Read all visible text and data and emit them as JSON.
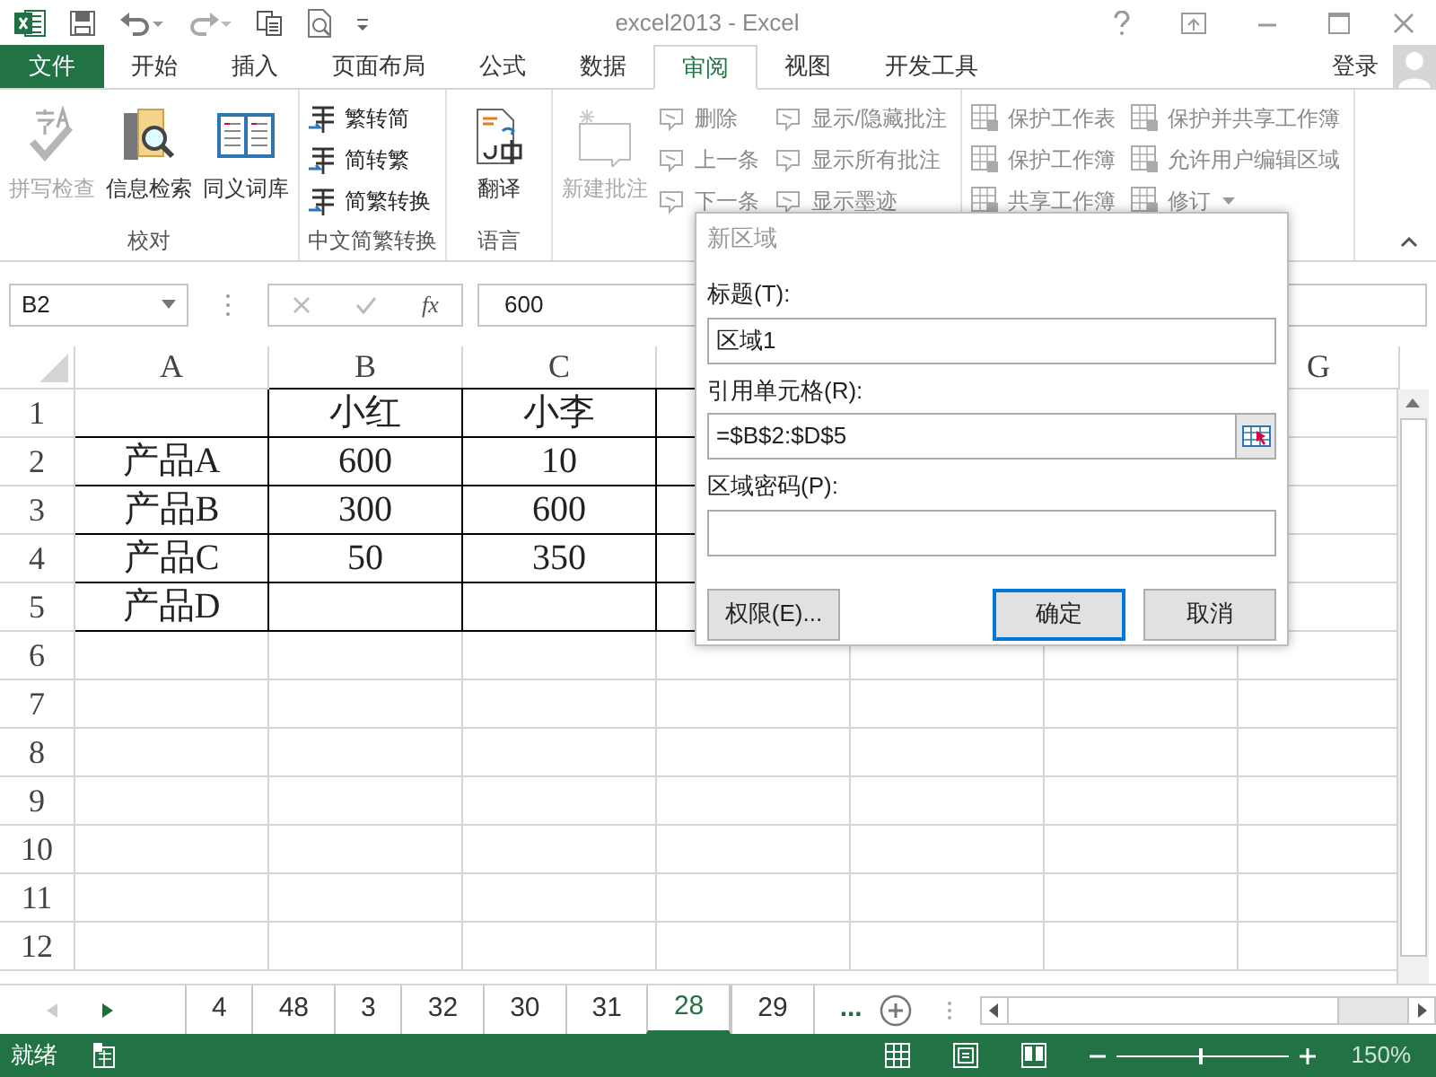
{
  "title_bar": {
    "title": "excel2013 - Excel"
  },
  "tabs": [
    {
      "label": "文件",
      "kind": "file",
      "selected": false
    },
    {
      "label": "开始",
      "kind": "tab",
      "selected": false
    },
    {
      "label": "插入",
      "kind": "tab",
      "selected": false
    },
    {
      "label": "页面布局",
      "kind": "tab",
      "selected": false
    },
    {
      "label": "公式",
      "kind": "tab",
      "selected": false
    },
    {
      "label": "数据",
      "kind": "tab",
      "selected": false
    },
    {
      "label": "审阅",
      "kind": "tab",
      "selected": true
    },
    {
      "label": "视图",
      "kind": "tab",
      "selected": false
    },
    {
      "label": "开发工具",
      "kind": "tab",
      "selected": false
    }
  ],
  "account": {
    "label": "登录"
  },
  "ribbon": {
    "groups": [
      {
        "label": "校对",
        "controls": [
          {
            "kind": "large",
            "label": "拼写检查",
            "disabled": true
          },
          {
            "kind": "large",
            "label": "信息检索",
            "disabled": false
          },
          {
            "kind": "large",
            "label": "同义词库",
            "disabled": false
          }
        ]
      },
      {
        "label": "中文简繁转换",
        "controls": [
          {
            "kind": "stack",
            "items": [
              {
                "label": "繁转简",
                "disabled": false
              },
              {
                "label": "简转繁",
                "disabled": false
              },
              {
                "label": "简繁转换",
                "disabled": false
              }
            ]
          }
        ]
      },
      {
        "label": "语言",
        "controls": [
          {
            "kind": "large",
            "label": "翻译",
            "disabled": false
          }
        ]
      },
      {
        "controls": [
          {
            "kind": "large",
            "label": "新建批注",
            "disabled": true
          },
          {
            "kind": "stack",
            "items": [
              {
                "label": "删除",
                "disabled": true
              },
              {
                "label": "上一条",
                "disabled": true
              },
              {
                "label": "下一条",
                "disabled": true
              }
            ]
          },
          {
            "kind": "stack",
            "items": [
              {
                "label": "显示/隐藏批注",
                "disabled": true
              },
              {
                "label": "显示所有批注",
                "disabled": true
              },
              {
                "label": "显示墨迹",
                "disabled": true
              }
            ]
          }
        ]
      },
      {
        "controls": [
          {
            "kind": "stack",
            "items": [
              {
                "label": "保护工作表",
                "disabled": true
              },
              {
                "label": "保护工作簿",
                "disabled": true
              },
              {
                "label": "共享工作簿",
                "disabled": true
              }
            ]
          },
          {
            "kind": "stack",
            "items": [
              {
                "label": "保护并共享工作簿",
                "disabled": true
              },
              {
                "label": "允许用户编辑区域",
                "disabled": true
              },
              {
                "label": "修订",
                "disabled": true,
                "dropdown": true
              }
            ]
          }
        ]
      }
    ]
  },
  "formula_bar": {
    "name_box": "B2",
    "fx": "fx",
    "value": "600"
  },
  "sheet": {
    "columns": [
      {
        "label": "A"
      },
      {
        "label": "B"
      },
      {
        "label": "C"
      },
      {},
      {},
      {},
      {
        "label": "G"
      }
    ],
    "rows": [
      {
        "number": "1",
        "cells": [
          null,
          "小红",
          "小李"
        ]
      },
      {
        "number": "2",
        "cells": [
          "产品A",
          "600",
          "10"
        ]
      },
      {
        "number": "3",
        "cells": [
          "产品B",
          "300",
          "600"
        ]
      },
      {
        "number": "4",
        "cells": [
          "产品C",
          "50",
          "350"
        ]
      },
      {
        "number": "5",
        "cells": [
          "产品D"
        ]
      },
      {
        "number": "6"
      },
      {
        "number": "7"
      },
      {
        "number": "8"
      },
      {
        "number": "9"
      },
      {
        "number": "10"
      },
      {
        "number": "11"
      },
      {
        "number": "12"
      }
    ]
  },
  "dialog": {
    "title": "新区域",
    "fields": [
      {
        "label": "标题(T):",
        "value": "区域1"
      },
      {
        "label": "引用单元格(R):",
        "value": "=$B$2:$D$5",
        "picker": true
      },
      {
        "label": "区域密码(P):"
      }
    ],
    "buttons": [
      {
        "label": "权限(E)...",
        "default": false
      },
      {
        "label": "确定",
        "default": true
      },
      {
        "label": "取消",
        "default": false
      }
    ]
  },
  "sheet_tabs": {
    "tabs": [
      {
        "label": "4",
        "selected": false
      },
      {
        "label": "48",
        "selected": false
      },
      {
        "label": "3",
        "selected": false
      },
      {
        "label": "32",
        "selected": false
      },
      {
        "label": "30",
        "selected": false
      },
      {
        "label": "31",
        "selected": false
      },
      {
        "label": "28",
        "selected": true
      },
      {
        "label": "29",
        "selected": false
      }
    ],
    "more": "..."
  },
  "status_bar": {
    "status": "就绪",
    "zoom_slider": {
      "level": 0.48
    },
    "zoom": "150%"
  }
}
